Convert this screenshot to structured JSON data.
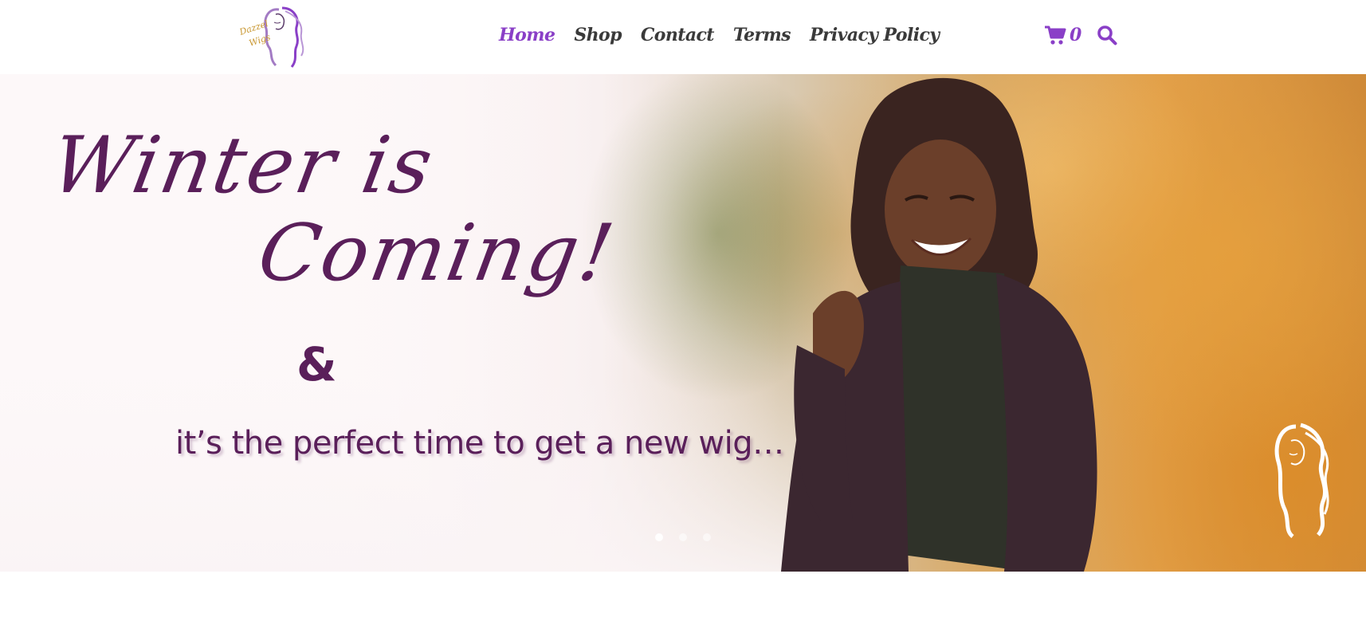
{
  "header": {
    "logo": {
      "text_line1": "Dazzel",
      "text_line2": "Wigs",
      "icon": "woman-hair-logo-icon"
    },
    "nav": [
      {
        "label": "Home",
        "active": true
      },
      {
        "label": "Shop",
        "active": false
      },
      {
        "label": "Contact",
        "active": false
      },
      {
        "label": "Terms",
        "active": false
      },
      {
        "label": "Privacy Policy",
        "active": false
      }
    ],
    "cart": {
      "icon": "cart-icon",
      "count": "0"
    },
    "search": {
      "icon": "search-icon"
    }
  },
  "hero": {
    "headline_line1": "Winter is",
    "headline_line2": "Coming!",
    "ampersand": "&",
    "tagline": "it’s the perfect time to get a new wig…",
    "watermark_icon": "woman-hair-logo-icon",
    "slides": {
      "count": 3,
      "active": 0
    }
  },
  "colors": {
    "accent": "#8a3fc7",
    "nav_text": "#3a3a3a",
    "headline": "#5a1f5a",
    "logo_gold": "#c8962e"
  }
}
